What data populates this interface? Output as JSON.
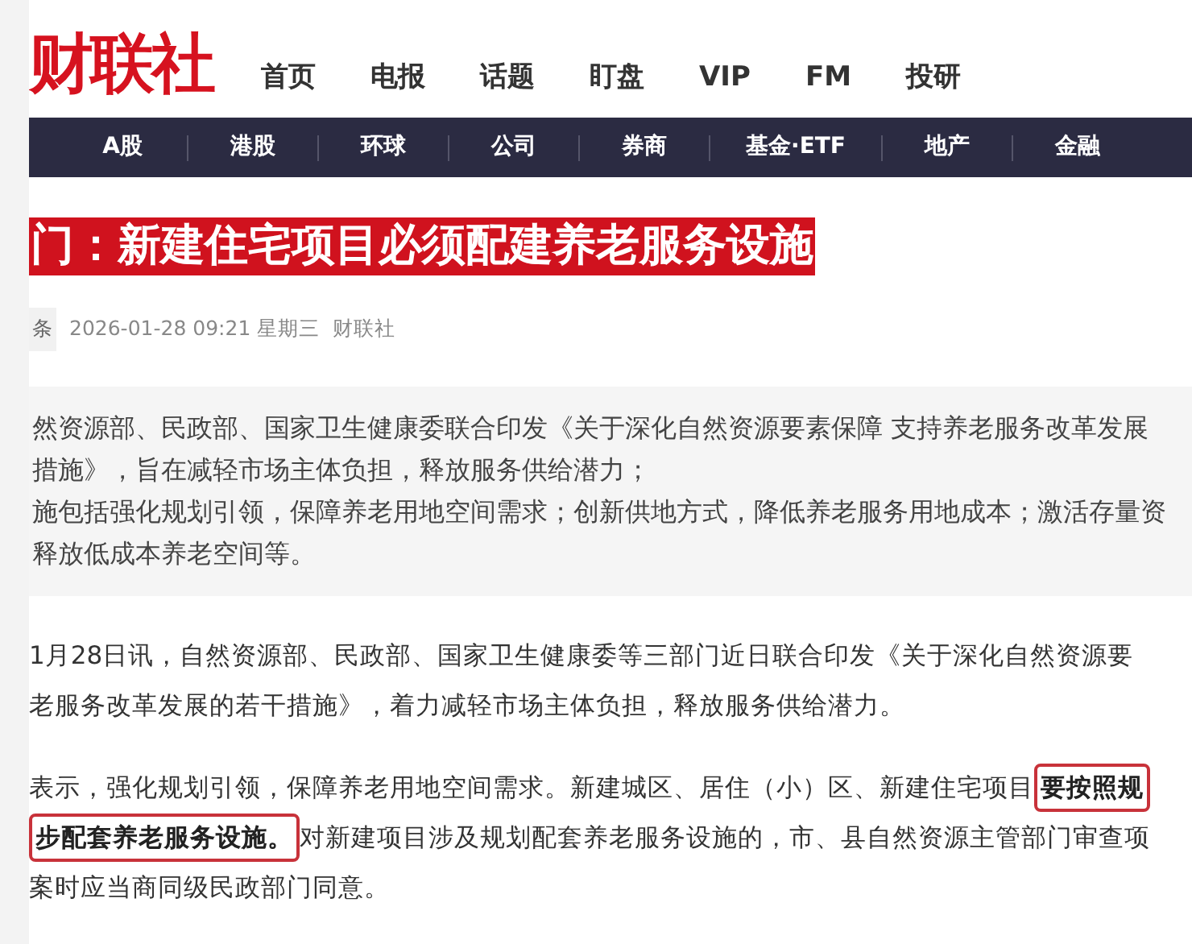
{
  "header": {
    "logo": "财联社",
    "nav": [
      {
        "label": "首页"
      },
      {
        "label": "电报"
      },
      {
        "label": "话题"
      },
      {
        "label": "盯盘"
      },
      {
        "label": "VIP"
      },
      {
        "label": "FM"
      },
      {
        "label": "投研"
      }
    ]
  },
  "categories": [
    {
      "label": "A股"
    },
    {
      "label": "港股"
    },
    {
      "label": "环球"
    },
    {
      "label": "公司"
    },
    {
      "label": "券商"
    },
    {
      "label": "基金·ETF"
    },
    {
      "label": "地产"
    },
    {
      "label": "金融"
    }
  ],
  "article": {
    "title": "门：新建住宅项目必须配建养老服务设施",
    "tag": "条",
    "date": "2026-01-28 09:21 星期三",
    "source": "财联社",
    "summary": [
      "然资源部、民政部、国家卫生健康委联合印发《关于深化自然资源要素保障 支持养老服务改革发展",
      "措施》，旨在减轻市场主体负担，释放服务供给潜力；",
      "施包括强化规划引领，保障养老用地空间需求；创新供地方式，降低养老服务用地成本；激活存量资",
      "释放低成本养老空间等。"
    ],
    "paragraphs": [
      {
        "lines": [
          [
            {
              "text": "1月28日讯，自然资源部、民政部、国家卫生健康委等三部门近日联合印发《关于深化自然资源要",
              "boxed": false
            }
          ],
          [
            {
              "text": "老服务改革发展的若干措施》，着力减轻市场主体负担，释放服务供给潜力。",
              "boxed": false
            }
          ]
        ]
      },
      {
        "lines": [
          [
            {
              "text": "表示，强化规划引领，保障养老用地空间需求。新建城区、居住（小）区、新建住宅项目",
              "boxed": false
            },
            {
              "text": "要按照规",
              "boxed": true
            }
          ],
          [
            {
              "text": "步配套养老服务设施。",
              "boxed": true
            },
            {
              "text": "对新建项目涉及规划配套养老服务设施的，市、县自然资源主管部门审查项",
              "boxed": false
            }
          ],
          [
            {
              "text": "案时应当商同级民政部门同意。",
              "boxed": false
            }
          ]
        ]
      }
    ]
  }
}
